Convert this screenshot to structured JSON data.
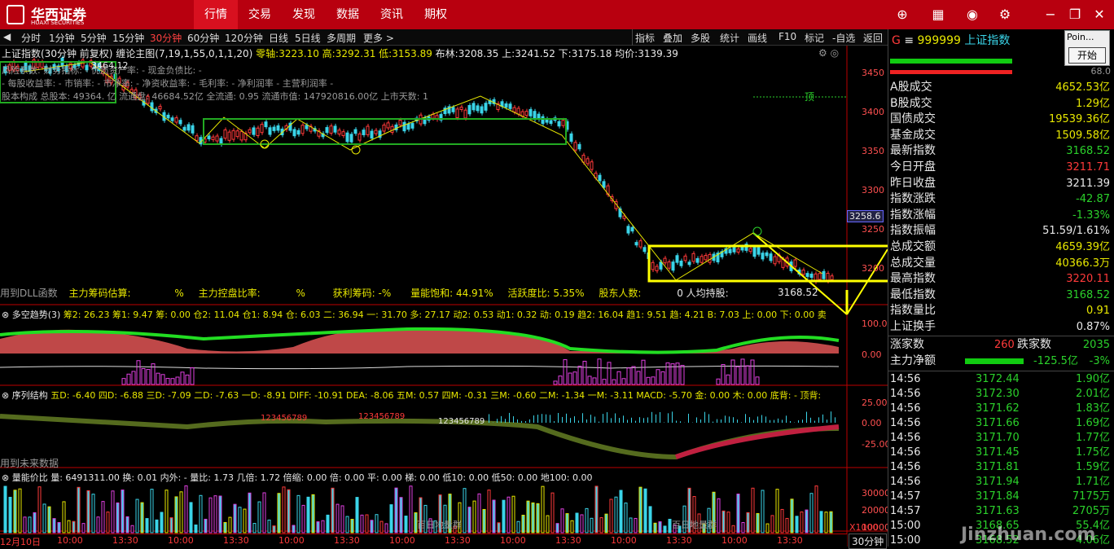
{
  "app": {
    "logo_cn": "华西证券",
    "logo_en": "HUAXI SECURITIES"
  },
  "nav": [
    "行情",
    "交易",
    "发现",
    "数据",
    "资讯",
    "期权"
  ],
  "periods": [
    "分时",
    "1分钟",
    "5分钟",
    "15分钟",
    "30分钟",
    "60分钟",
    "120分钟",
    "日线",
    "5日线",
    "多周期",
    "更多 >"
  ],
  "tools": [
    "指标",
    "叠加",
    "多股",
    "统计",
    "画线",
    "F10",
    "标记",
    "-自选",
    "返回"
  ],
  "header": {
    "title": "上证指数(30分钟 前复权)",
    "indicator": "缠论主图(7,19,1,55,0,1,1,20)",
    "zero_axis_label": "零轴:",
    "zero_axis": "3223.10",
    "high_label": "高:",
    "high": "3292.31",
    "low_label": "低:",
    "low": "3153.89",
    "boll_label": "布林:",
    "boll": "3208.35",
    "up_label": "上:",
    "up": "3241.52",
    "down_label": "下:",
    "down": "3175.18",
    "avg_label": "均价:",
    "avg": "3139.39"
  },
  "overlay": {
    "line1": "风险系数: 财务指标: - 优质资产率: - 现金负债比: -",
    "line2": "- 每股收益率: - 市销率: - 市净率: - 净资收益率: - 毛利率: - 净利润率 - 主营利润率 -",
    "line3": "股本构成 总股本: 49364.  亿 流通盘: 46684.52亿 全流通: 0.95 流通市值: 147920816.00亿 上市天数: 1",
    "peak": "3464.12",
    "ding": "顶",
    "box_label": "3258.6",
    "last_price": "3168.52"
  },
  "main_footer": {
    "dll": "用到DLL函数",
    "f1": "主力筹码估算:",
    "f1v": "%",
    "f2": "主力控盘比率:",
    "f2v": "%",
    "f3": "获利筹码: -%",
    "f4": "量能饱和: 44.91%",
    "f5": "活跃度比: 5.35%",
    "f6": "股东人数:",
    "f7": "0 人均持股:"
  },
  "main_axis": [
    "3450",
    "3400",
    "3350",
    "3300",
    "3250",
    "3200"
  ],
  "p2": {
    "label": "多空趋势(3)",
    "vals": "筹2: 26.23  筹1: 9.47  筹: 0.00  仓2: 11.04  仓1: 8.94  仓: 6.03  二: 36.94  一: 31.70  多: 27.17  动2: 0.53  动1: 0.32  动: 0.19  趋2: 16.04  趋1: 9.51  趋: 4.21  B: 7.03  上: 0.00  下: 0.00  卖",
    "axis": [
      "100.0",
      "0.00"
    ]
  },
  "p3": {
    "label": "序列结构",
    "vals": "五D: -6.40  四D: -6.88  三D: -7.09  二D: -7.63  一D: -8.91  DIFF: -10.91  DEA: -8.06  五M: 0.57  四M: -0.31  三M: -0.60  二M: -1.34  一M: -3.11  MACD: -5.70  金: 0.00  木: 0.00  底背: -  顶背:",
    "axis": [
      "25.00",
      "0.00",
      "-25.00"
    ],
    "footer": "用到未来数据",
    "seq": "123456789"
  },
  "p4": {
    "label": "量能价比",
    "vals": "量: 6491311.00  换: 0.01  内外: -  量比: 1.73  几倍: 1.72  倍缩: 0.00  倍: 0.00  平: 0.00  梯: 0.00  低10: 0.00  低50: 0.00  地100: 0.00",
    "axis": [
      "30000",
      "20000",
      "10000"
    ],
    "unit": "X1000",
    "note": "百日地量群"
  },
  "xaxis": [
    "12月10日",
    "10:00",
    "13:30",
    "10:00",
    "13:30",
    "10:00",
    "13:30",
    "10:00",
    "13:30",
    "10:00",
    "13:30",
    "10:00",
    "13:30",
    "10:00",
    "13:30"
  ],
  "period_sel": "30分钟",
  "popup": {
    "title": "Poin...",
    "btn": "开始"
  },
  "right": {
    "code": "999999",
    "name": "上证指数",
    "pct_top": "68.0",
    "rows": [
      [
        "A股成交",
        "4652.53亿",
        "#e8e800"
      ],
      [
        "B股成交",
        "1.29亿",
        "#e8e800"
      ],
      [
        "国债成交",
        "19539.36亿",
        "#e8e800"
      ],
      [
        "基金成交",
        "1509.58亿",
        "#e8e800"
      ],
      [
        "最新指数",
        "3168.52",
        "#2bd12b"
      ],
      [
        "今日开盘",
        "3211.71",
        "#ff3a3a"
      ],
      [
        "昨日收盘",
        "3211.39",
        "#e8e8e8"
      ],
      [
        "指数涨跌",
        "-42.87",
        "#2bd12b"
      ],
      [
        "指数涨幅",
        "-1.33%",
        "#2bd12b"
      ],
      [
        "指数振幅",
        "51.59/1.61%",
        "#e8e8e8"
      ],
      [
        "总成交额",
        "4659.39亿",
        "#e8e800"
      ],
      [
        "总成交量",
        "40366.3万",
        "#e8e800"
      ],
      [
        "最高指数",
        "3220.11",
        "#ff3a3a"
      ],
      [
        "最低指数",
        "3168.52",
        "#2bd12b"
      ],
      [
        "指数量比",
        "0.91",
        "#e8e800"
      ],
      [
        "上证换手",
        "0.87%",
        "#e8e8e8"
      ]
    ],
    "up_label": "涨家数",
    "up": "260",
    "down_label": "跌家数",
    "down": "2035",
    "net_label": "主力净额",
    "net": "-125.5亿",
    "net_pct": "-3%",
    "ticks": [
      [
        "14:56",
        "3172.44",
        "1.90亿"
      ],
      [
        "14:56",
        "3172.30",
        "2.01亿"
      ],
      [
        "14:56",
        "3171.62",
        "1.83亿"
      ],
      [
        "14:56",
        "3171.66",
        "1.69亿"
      ],
      [
        "14:56",
        "3171.70",
        "1.77亿"
      ],
      [
        "14:56",
        "3171.45",
        "1.75亿"
      ],
      [
        "14:56",
        "3171.81",
        "1.59亿"
      ],
      [
        "14:56",
        "3171.94",
        "1.71亿"
      ],
      [
        "14:57",
        "3171.84",
        "7175万"
      ],
      [
        "14:57",
        "3171.63",
        "2705万"
      ],
      [
        "15:00",
        "3168.65",
        "55.4亿"
      ],
      [
        "15:00",
        "3168.52",
        "4.06亿"
      ]
    ]
  },
  "watermark": "Jinzhuan.com"
}
